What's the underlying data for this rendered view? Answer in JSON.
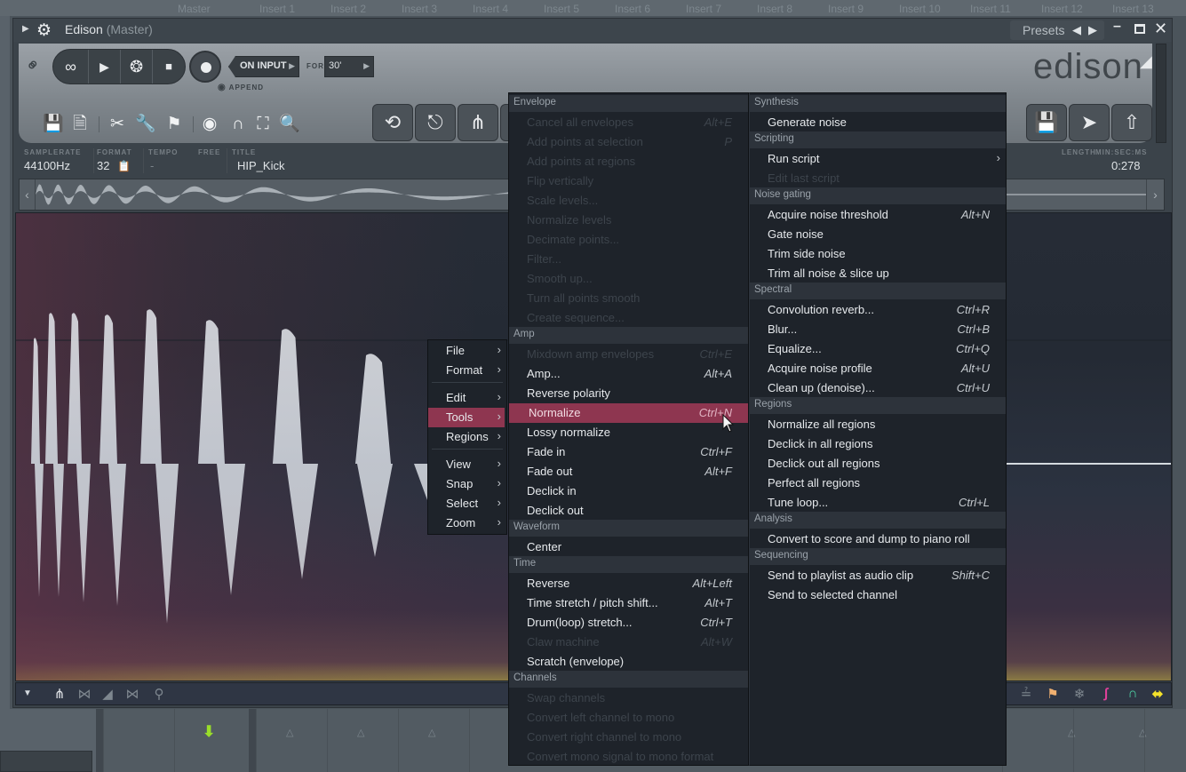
{
  "mixer": {
    "tracks": [
      "Master",
      "Insert 1",
      "Insert 2",
      "Insert 3",
      "Insert 4",
      "Insert 5",
      "Insert 6",
      "Insert 7",
      "Insert 8",
      "Insert 9",
      "Insert 10",
      "Insert 11",
      "Insert 12",
      "Insert 13"
    ]
  },
  "window": {
    "title": "Edison",
    "subtitle": "(Master)",
    "presets_label": "Presets",
    "logo": "edison"
  },
  "transport": {
    "on_input_label": "ON INPUT",
    "for_label": "FOR",
    "for_value": "30'",
    "append_label": "APPEND"
  },
  "info": {
    "samplerate_label": "SAMPLERATE",
    "samplerate_value": "44100Hz",
    "format_label": "FORMAT",
    "format_value": "32",
    "tempo_label": "TEMPO",
    "tempo_value": "-",
    "free_label": "FREE",
    "title_label": "TITLE",
    "title_value": "HIP_Kick",
    "length_label": "LENGTH",
    "time_format_label": "MIN:SEC:MS",
    "length_value": "0:278"
  },
  "main_menu": {
    "items": [
      {
        "label": "File"
      },
      {
        "label": "Format"
      },
      {
        "label": "Edit"
      },
      {
        "label": "Tools",
        "active": true
      },
      {
        "label": "Regions"
      },
      {
        "label": "View"
      },
      {
        "label": "Snap"
      },
      {
        "label": "Select"
      },
      {
        "label": "Zoom"
      }
    ]
  },
  "tools_menu_left": {
    "sections": [
      {
        "header": "Envelope",
        "items": [
          {
            "label": "Cancel all envelopes",
            "shortcut": "Alt+E",
            "disabled": true
          },
          {
            "label": "Add points at selection",
            "shortcut": "P",
            "disabled": true
          },
          {
            "label": "Add points at regions",
            "shortcut": "",
            "disabled": true
          },
          {
            "label": "Flip vertically",
            "shortcut": "",
            "disabled": true
          },
          {
            "label": "Scale levels...",
            "shortcut": "",
            "disabled": true
          },
          {
            "label": "Normalize levels",
            "shortcut": "",
            "disabled": true
          },
          {
            "label": "Decimate points...",
            "shortcut": "",
            "disabled": true
          },
          {
            "label": "Filter...",
            "shortcut": "",
            "disabled": true
          },
          {
            "label": "Smooth up...",
            "shortcut": "",
            "disabled": true
          },
          {
            "label": "Turn all points smooth",
            "shortcut": "",
            "disabled": true
          },
          {
            "label": "Create sequence...",
            "shortcut": "",
            "disabled": true
          }
        ]
      },
      {
        "header": "Amp",
        "items": [
          {
            "label": "Mixdown amp envelopes",
            "shortcut": "Ctrl+E",
            "disabled": true
          },
          {
            "label": "Amp...",
            "shortcut": "Alt+A"
          },
          {
            "label": "Reverse polarity",
            "shortcut": ""
          },
          {
            "label": "Normalize",
            "shortcut": "Ctrl+N",
            "active": true
          },
          {
            "label": "Lossy normalize",
            "shortcut": ""
          },
          {
            "label": "Fade in",
            "shortcut": "Ctrl+F"
          },
          {
            "label": "Fade out",
            "shortcut": "Alt+F"
          },
          {
            "label": "Declick in",
            "shortcut": ""
          },
          {
            "label": "Declick out",
            "shortcut": ""
          }
        ]
      },
      {
        "header": "Waveform",
        "items": [
          {
            "label": "Center",
            "shortcut": ""
          }
        ]
      },
      {
        "header": "Time",
        "items": [
          {
            "label": "Reverse",
            "shortcut": "Alt+Left"
          },
          {
            "label": "Time stretch / pitch shift...",
            "shortcut": "Alt+T"
          },
          {
            "label": "Drum(loop) stretch...",
            "shortcut": "Ctrl+T"
          },
          {
            "label": "Claw machine",
            "shortcut": "Alt+W",
            "disabled": true
          },
          {
            "label": "Scratch (envelope)",
            "shortcut": ""
          }
        ]
      },
      {
        "header": "Channels",
        "items": [
          {
            "label": "Swap channels",
            "shortcut": "",
            "disabled": true
          },
          {
            "label": "Convert left channel to mono",
            "shortcut": "",
            "disabled": true
          },
          {
            "label": "Convert right channel to mono",
            "shortcut": "",
            "disabled": true
          },
          {
            "label": "Convert mono signal to mono format",
            "shortcut": "",
            "disabled": true
          }
        ]
      }
    ]
  },
  "tools_menu_right": {
    "sections": [
      {
        "header": "Synthesis",
        "items": [
          {
            "label": "Generate noise",
            "shortcut": ""
          }
        ]
      },
      {
        "header": "Scripting",
        "items": [
          {
            "label": "Run script",
            "shortcut": "",
            "submenu": true
          },
          {
            "label": "Edit last script",
            "shortcut": "",
            "disabled": true
          }
        ]
      },
      {
        "header": "Noise gating",
        "items": [
          {
            "label": "Acquire noise threshold",
            "shortcut": "Alt+N"
          },
          {
            "label": "Gate noise",
            "shortcut": ""
          },
          {
            "label": "Trim side noise",
            "shortcut": ""
          },
          {
            "label": "Trim all noise & slice up",
            "shortcut": ""
          }
        ]
      },
      {
        "header": "Spectral",
        "items": [
          {
            "label": "Convolution reverb...",
            "shortcut": "Ctrl+R"
          },
          {
            "label": "Blur...",
            "shortcut": "Ctrl+B"
          },
          {
            "label": "Equalize...",
            "shortcut": "Ctrl+Q"
          },
          {
            "label": "Acquire noise profile",
            "shortcut": "Alt+U"
          },
          {
            "label": "Clean up (denoise)...",
            "shortcut": "Ctrl+U"
          }
        ]
      },
      {
        "header": "Regions",
        "items": [
          {
            "label": "Normalize all regions",
            "shortcut": ""
          },
          {
            "label": "Declick in all regions",
            "shortcut": ""
          },
          {
            "label": "Declick out all regions",
            "shortcut": ""
          },
          {
            "label": "Perfect all regions",
            "shortcut": ""
          },
          {
            "label": "Tune loop...",
            "shortcut": "Ctrl+L"
          }
        ]
      },
      {
        "header": "Analysis",
        "items": [
          {
            "label": "Convert to score and dump to piano roll",
            "shortcut": ""
          }
        ]
      },
      {
        "header": "Sequencing",
        "items": [
          {
            "label": "Send to playlist as audio clip",
            "shortcut": "Shift+C"
          },
          {
            "label": "Send to selected channel",
            "shortcut": ""
          }
        ]
      }
    ]
  },
  "colors": {
    "highlight": "#8e3650",
    "menu_bg": "#1e232a",
    "accent_green": "#9ade2a",
    "accent_pink": "#e0409a",
    "accent_teal": "#4fd8a8",
    "accent_yellow": "#f4e22a",
    "accent_orange": "#f0b070"
  }
}
